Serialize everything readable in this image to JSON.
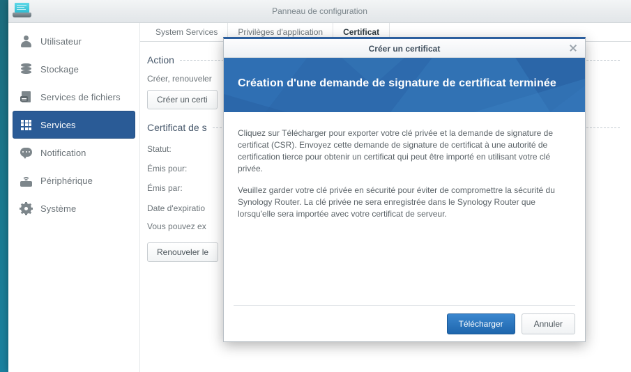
{
  "window": {
    "title": "Panneau de configuration",
    "icon": "control-panel-monitor-icon"
  },
  "sidebar": {
    "items": [
      {
        "label": "Utilisateur",
        "icon": "user-icon",
        "selected": false
      },
      {
        "label": "Stockage",
        "icon": "storage-disk-icon",
        "selected": false
      },
      {
        "label": "Services de fichiers",
        "icon": "file-services-icon",
        "selected": false
      },
      {
        "label": "Services",
        "icon": "services-grid-icon",
        "selected": true
      },
      {
        "label": "Notification",
        "icon": "notification-bubble-icon",
        "selected": false
      },
      {
        "label": "Périphérique",
        "icon": "device-router-icon",
        "selected": false
      },
      {
        "label": "Système",
        "icon": "system-gear-icon",
        "selected": false
      }
    ]
  },
  "tabs": [
    {
      "label": "System Services",
      "active": false
    },
    {
      "label": "Privilèges d'application",
      "active": false
    },
    {
      "label": "Certificat",
      "active": true
    }
  ],
  "panel": {
    "action_section": {
      "heading": "Action",
      "description": "Créer, renouveler",
      "button_label": "Créer un certi"
    },
    "certificate_section": {
      "heading": "Certificat de s",
      "rows": [
        "Statut:",
        "Émis pour:",
        "Émis par:",
        "Date d'expiratio",
        "Vous pouvez ex"
      ],
      "button_label": "Renouveler le"
    }
  },
  "dialog": {
    "titlebar": "Créer un certificat",
    "close_icon": "close-icon",
    "banner_title": "Création d'une demande de signature de certificat terminée",
    "paragraphs": [
      "Cliquez sur Télécharger pour exporter votre clé privée et la demande de signature de certificat (CSR). Envoyez cette demande de signature de certificat à une autorité de certification tierce pour obtenir un certificat qui peut être importé en utilisant votre clé privée.",
      "Veuillez garder votre clé privée en sécurité pour éviter de compromettre la sécurité du Synology Router. La clé privée ne sera enregistrée dans le Synology Router que lorsqu'elle sera importée avec votre certificat de serveur."
    ],
    "primary_button": "Télécharger",
    "secondary_button": "Annuler"
  },
  "colors": {
    "desktop_teal": "#1c6c7d",
    "sidebar_selected": "#2a5b96",
    "banner_blue": "#2e6cb0",
    "primary_button": "#1e66ad",
    "dialog_top_border": "#2c5f9e"
  }
}
